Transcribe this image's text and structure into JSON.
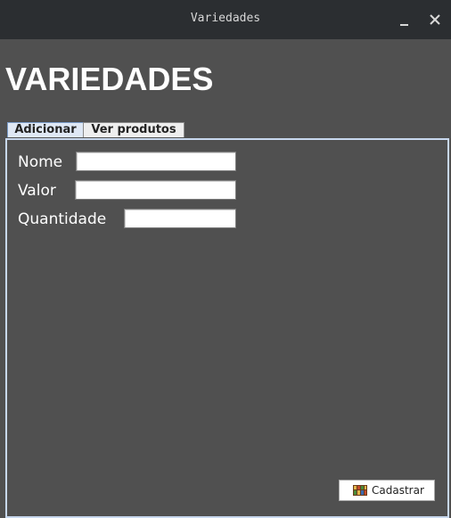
{
  "window": {
    "title": "Variedades",
    "minimize_label": "_",
    "close_label": "✕"
  },
  "header": {
    "heading": "VARIEDADES"
  },
  "tabs": [
    {
      "label": "Adicionar",
      "active": true
    },
    {
      "label": "Ver produtos",
      "active": false
    }
  ],
  "form": {
    "fields": [
      {
        "label": "Nome",
        "value": ""
      },
      {
        "label": "Valor",
        "value": ""
      },
      {
        "label": "Quantidade",
        "value": ""
      }
    ],
    "submit_label": "Cadastrar",
    "submit_icon": "register-icon"
  },
  "colors": {
    "titlebar": "#2b2e31",
    "background": "#505050",
    "active_tab": "#dfe8f5",
    "panel_border": "#c8d8ee"
  }
}
